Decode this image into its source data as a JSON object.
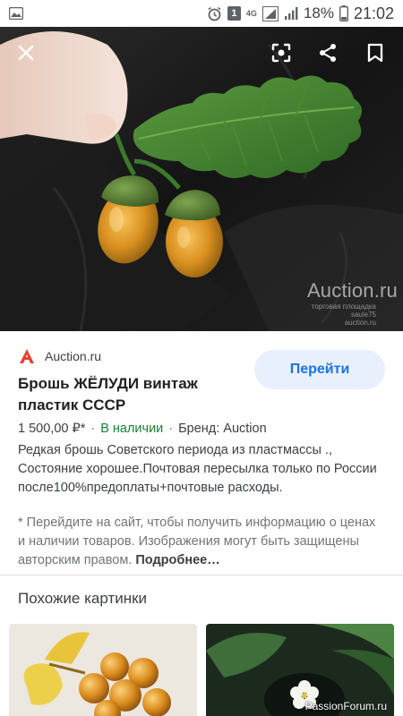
{
  "status_bar": {
    "battery_percent": "18%",
    "time": "21:02",
    "network": "4G",
    "sim_badge": "1"
  },
  "hero": {
    "watermark": "Auction.ru",
    "watermark_small_1": "торговая площадка",
    "watermark_small_2": "saule75",
    "watermark_small_3": "auction.ru",
    "icons": [
      "close-icon",
      "lens-icon",
      "share-icon",
      "bookmark-icon"
    ]
  },
  "product": {
    "source": "Auction.ru",
    "visit_label": "Перейти",
    "title": "Брошь ЖЁЛУДИ винтаж пластик СССР",
    "price": "1 500,00 ₽*",
    "availability": "В наличии",
    "brand": "Бренд: Auction",
    "description": "Редкая брошь Советского периода из пластмассы ., Состояние хорошее.Почтовая пересылка только по России после100%предоплаты+почтовые расходы.",
    "notice": "* Перейдите на сайт, чтобы получить информацию о ценах и наличии товаров. Изображения могут быть защищены авторским правом.",
    "more_label": "Подробнее…"
  },
  "similar": {
    "title": "Похожие картинки",
    "watermark": "PassionForum.ru"
  },
  "colors": {
    "accent": "#1a73e8",
    "accent_bg": "#e8f0fe",
    "in_stock": "#188038",
    "source_logo": "#e8412b"
  }
}
